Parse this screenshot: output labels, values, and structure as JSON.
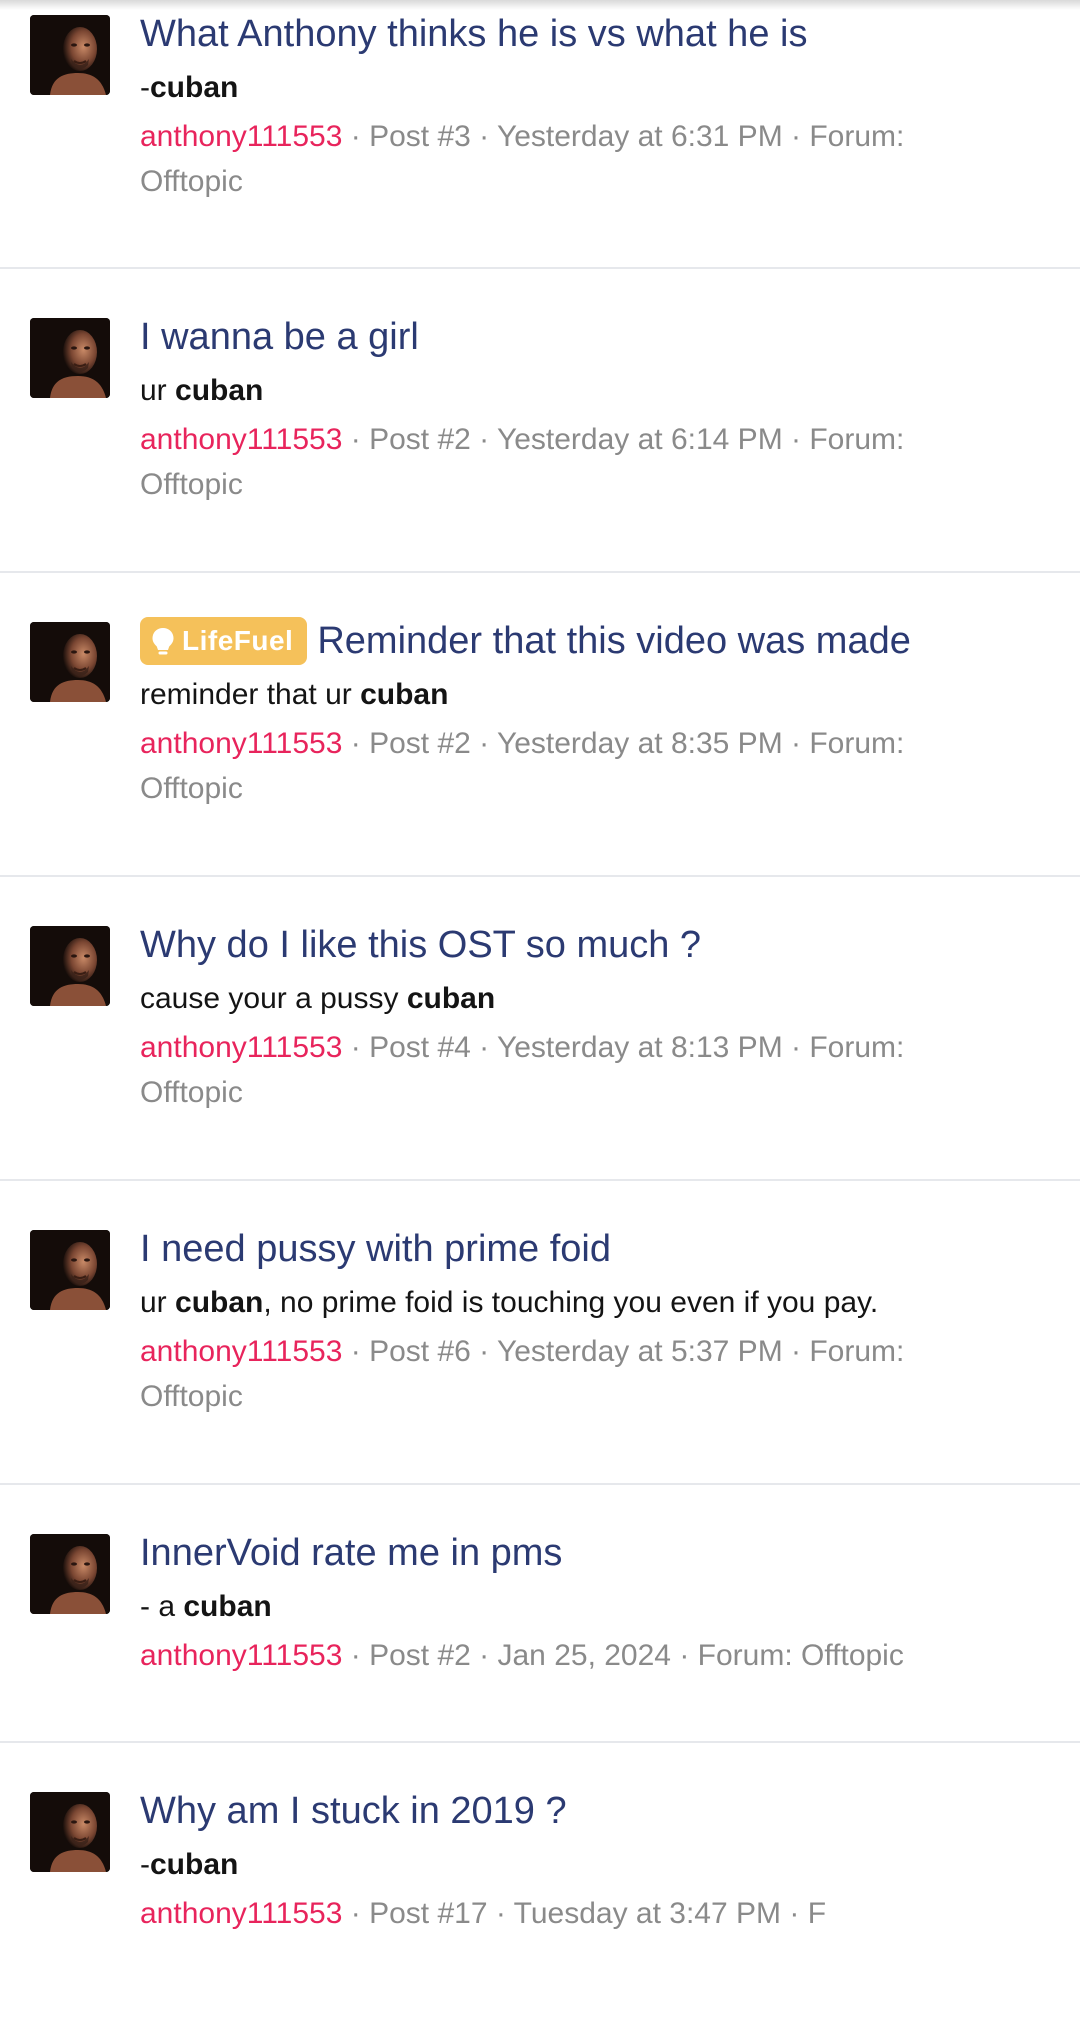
{
  "badge_label": "LifeFuel",
  "results": [
    {
      "title": "What Anthony thinks he is vs what he is",
      "snippet_pre": "-",
      "snippet_bold": "cuban",
      "snippet_post": "",
      "user": "anthony111553",
      "post": "Post #3",
      "time": "Yesterday at 6:31 PM",
      "forum_label": "Forum:",
      "forum": "Offtopic"
    },
    {
      "title": "I wanna be a girl",
      "snippet_pre": "ur ",
      "snippet_bold": "cuban",
      "snippet_post": "",
      "user": "anthony111553",
      "post": "Post #2",
      "time": "Yesterday at 6:14 PM",
      "forum_label": "Forum:",
      "forum": "Offtopic"
    },
    {
      "badge": "LifeFuel",
      "title": "Reminder that this video was made",
      "snippet_pre": "reminder that ur ",
      "snippet_bold": "cuban",
      "snippet_post": "",
      "user": "anthony111553",
      "post": "Post #2",
      "time": "Yesterday at 8:35 PM",
      "forum_label": "Forum:",
      "forum": "Offtopic"
    },
    {
      "title": "Why do I like this OST so much ?",
      "snippet_pre": "cause your a pussy ",
      "snippet_bold": "cuban",
      "snippet_post": "",
      "user": "anthony111553",
      "post": "Post #4",
      "time": "Yesterday at 8:13 PM",
      "forum_label": "Forum:",
      "forum": "Offtopic"
    },
    {
      "title": "I need pussy with prime foid",
      "snippet_pre": "ur ",
      "snippet_bold": "cuban",
      "snippet_post": ", no prime foid is touching you even if you pay.",
      "user": "anthony111553",
      "post": "Post #6",
      "time": "Yesterday at 5:37 PM",
      "forum_label": "Forum:",
      "forum": "Offtopic"
    },
    {
      "title": "InnerVoid rate me in pms",
      "snippet_pre": "- a ",
      "snippet_bold": "cuban",
      "snippet_post": "",
      "user": "anthony111553",
      "post": "Post #2",
      "time": "Jan 25, 2024",
      "forum_label": "Forum:",
      "forum": "Offtopic"
    },
    {
      "title": "Why am I stuck in 2019 ?",
      "snippet_pre": "-",
      "snippet_bold": "cuban",
      "snippet_post": "",
      "user": "anthony111553",
      "post": "Post #17",
      "time": "Tuesday at 3:47 PM",
      "forum_label": "F",
      "forum": ""
    }
  ],
  "colors": {
    "title": "#2b3a72",
    "username": "#e8245c",
    "meta": "#8a8a8a",
    "badge": "#f5c15a"
  },
  "icons": {
    "avatar": "user-avatar",
    "badge": "lightbulb-icon"
  }
}
